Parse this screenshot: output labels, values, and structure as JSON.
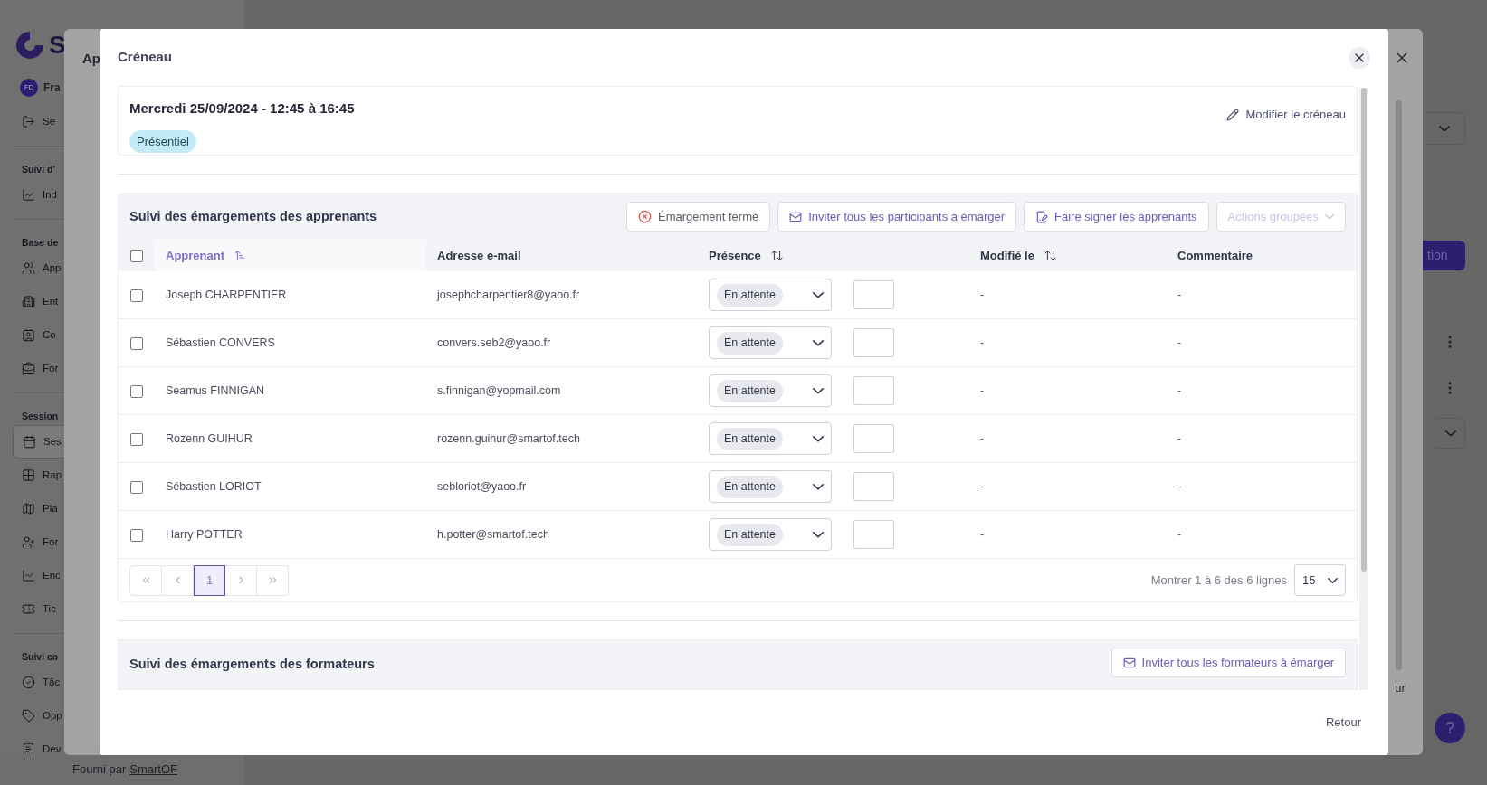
{
  "background": {
    "sidebar": {
      "brand": "S",
      "user": {
        "initials": "FD",
        "name": "Fra"
      },
      "items": [
        {
          "kind": "item",
          "label": "Se",
          "selected": false
        },
        {
          "kind": "section",
          "label": "Suivi d'"
        },
        {
          "kind": "item",
          "label": "Ind",
          "selected": false
        },
        {
          "kind": "section",
          "label": "Base de"
        },
        {
          "kind": "item",
          "label": "App",
          "selected": false
        },
        {
          "kind": "item",
          "label": "Ent",
          "selected": false
        },
        {
          "kind": "item",
          "label": "Co",
          "selected": false
        },
        {
          "kind": "item",
          "label": "For",
          "selected": false
        },
        {
          "kind": "section",
          "label": "Session"
        },
        {
          "kind": "item",
          "label": "Ses",
          "selected": true
        },
        {
          "kind": "item",
          "label": "Rap",
          "selected": false
        },
        {
          "kind": "item",
          "label": "Pla",
          "selected": false
        },
        {
          "kind": "item",
          "label": "For",
          "selected": false
        },
        {
          "kind": "item",
          "label": "Enc",
          "selected": false
        },
        {
          "kind": "item",
          "label": "Tic",
          "selected": false
        },
        {
          "kind": "section",
          "label": "Suivi co"
        },
        {
          "kind": "item",
          "label": "Tâc",
          "selected": false
        },
        {
          "kind": "item",
          "label": "Opp",
          "selected": false
        },
        {
          "kind": "item",
          "label": "Dev",
          "selected": false
        }
      ],
      "footer": {
        "prefix": "Fourni par",
        "link": "SmartOF"
      }
    },
    "back_modal": {
      "title": "Ap",
      "footer_fragment": "ur"
    },
    "page": {
      "button_fragment": "tion",
      "help": "?"
    }
  },
  "modal": {
    "title": "Créneau",
    "slot": {
      "title": "Mercredi 25/09/2024 - 12:45 à 16:45",
      "badge": "Présentiel",
      "edit_link": "Modifier le créneau"
    },
    "learners": {
      "title": "Suivi des émargements des apprenants",
      "actions": [
        {
          "kind": "closed",
          "label": "Émargement fermé",
          "disabled": false
        },
        {
          "kind": "mail",
          "label": "Inviter tous les participants à émarger",
          "disabled": false
        },
        {
          "kind": "sign",
          "label": "Faire signer les apprenants",
          "disabled": false
        },
        {
          "kind": "dropdown",
          "label": "Actions groupées",
          "disabled": true
        }
      ],
      "select_all": {
        "checked": false
      },
      "columns": [
        {
          "label": "Apprenant",
          "sortable": true,
          "active": true
        },
        {
          "label": "Adresse e-mail",
          "sortable": false,
          "active": false
        },
        {
          "label": "Présence",
          "sortable": true,
          "active": false
        },
        {
          "label": "Modifié le",
          "sortable": true,
          "active": false
        },
        {
          "label": "Commentaire",
          "sortable": false,
          "active": false
        }
      ],
      "rows": [
        {
          "checked": false,
          "name": "Joseph CHARPENTIER",
          "email": "josephcharpentier8@yaoo.fr",
          "presence": "En attente",
          "modified": "-",
          "comment": "-"
        },
        {
          "checked": false,
          "name": "Sébastien CONVERS",
          "email": "convers.seb2@yaoo.fr",
          "presence": "En attente",
          "modified": "-",
          "comment": "-"
        },
        {
          "checked": false,
          "name": "Seamus FINNIGAN",
          "email": "s.finnigan@yopmail.com",
          "presence": "En attente",
          "modified": "-",
          "comment": "-"
        },
        {
          "checked": false,
          "name": "Rozenn GUIHUR",
          "email": "rozenn.guihur@smartof.tech",
          "presence": "En attente",
          "modified": "-",
          "comment": "-"
        },
        {
          "checked": false,
          "name": "Sébastien LORIOT",
          "email": "sebloriot@yaoo.fr",
          "presence": "En attente",
          "modified": "-",
          "comment": "-"
        },
        {
          "checked": false,
          "name": "Harry POTTER",
          "email": "h.potter@smartof.tech",
          "presence": "En attente",
          "modified": "-",
          "comment": "-"
        }
      ],
      "pages": [
        {
          "label": "1",
          "selected": true
        }
      ],
      "summary": "Montrer 1 à 6 des 6 lignes",
      "page_size": "15"
    },
    "trainers": {
      "title": "Suivi des émargements des formateurs",
      "action": "Inviter tous les formateurs à émarger"
    },
    "footer_button": "Retour"
  }
}
